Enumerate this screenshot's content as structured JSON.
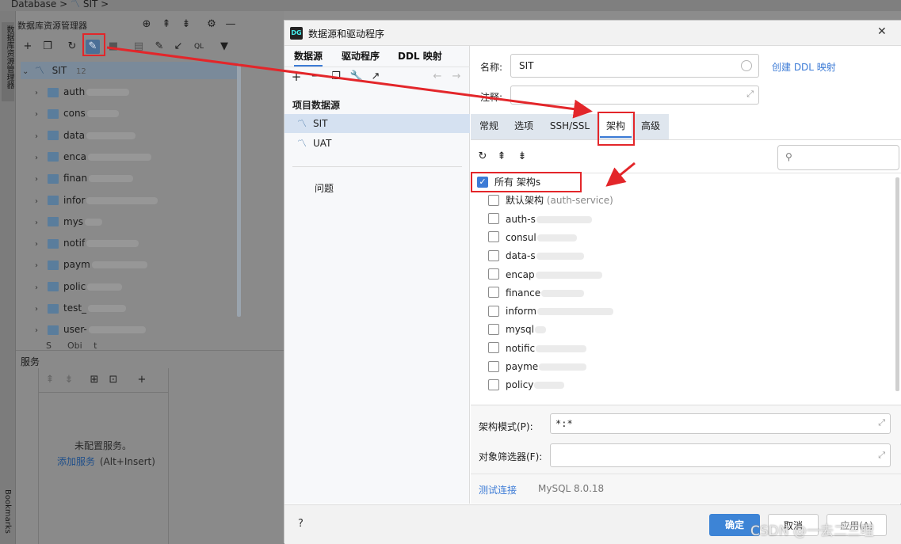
{
  "breadcrumb": {
    "db": "Database",
    "sep": ">",
    "sit": "SIT",
    "sep2": ">"
  },
  "side_vertical_label": "数据库资源管理器",
  "bottom_vertical_label": "Bookmarks",
  "db_explorer": {
    "title": "数据库资源管理器",
    "root": {
      "label": "SIT",
      "count": "12"
    },
    "schemas": [
      "auth",
      "cons",
      "data",
      "enca",
      "finan",
      "infor",
      "mys",
      "notif",
      "paym",
      "polic",
      "test_",
      "user-"
    ]
  },
  "services": {
    "title": "服务",
    "empty_text": "未配置服务。",
    "add_link": "添加服务",
    "add_shortcut": "(Alt+Insert)"
  },
  "dialog": {
    "title": "数据源和驱动程序",
    "left_tabs": [
      "数据源",
      "驱动程序",
      "DDL 映射"
    ],
    "section_label": "项目数据源",
    "datasources": [
      "SIT",
      "UAT"
    ],
    "problems": "问题",
    "name_label": "名称:",
    "name_value": "SIT",
    "create_ddl_link": "创建 DDL 映射",
    "comment_label": "注释:",
    "tabs": [
      "常规",
      "选项",
      "SSH/SSL",
      "架构",
      "高级"
    ],
    "active_tab": "架构",
    "schema_rows": [
      {
        "label": "所有 架构s",
        "checked": true
      },
      {
        "label": "默认架构",
        "extra": "(auth-service)",
        "checked": false
      },
      {
        "label": "auth-s",
        "checked": false
      },
      {
        "label": "consul",
        "checked": false
      },
      {
        "label": "data-s",
        "checked": false
      },
      {
        "label": "encap",
        "checked": false
      },
      {
        "label": "finance",
        "checked": false
      },
      {
        "label": "inform",
        "checked": false
      },
      {
        "label": "mysql",
        "checked": false
      },
      {
        "label": "notific",
        "checked": false
      },
      {
        "label": "payme",
        "checked": false
      },
      {
        "label": "policy",
        "checked": false
      }
    ],
    "schema_pattern_label": "架构模式(P):",
    "schema_pattern_value": "*:*",
    "object_filter_label": "对象筛选器(F):",
    "test_connection": "测试连接",
    "driver_version": "MySQL 8.0.18",
    "help": "?",
    "ok": "确定",
    "cancel": "取消",
    "apply": "应用(A)",
    "close": "✕"
  },
  "watermark": "CSDN @一去二三哩"
}
